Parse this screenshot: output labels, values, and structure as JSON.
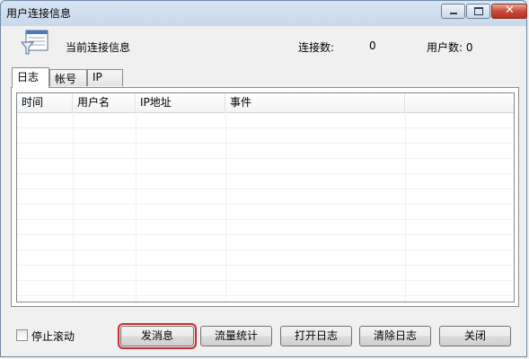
{
  "window": {
    "title": "用户连接信息"
  },
  "header": {
    "info_label": "当前连接信息",
    "conn_label": "连接数:",
    "conn_value": "0",
    "user_label": "用户数: 0"
  },
  "tabs": [
    "日志",
    "帐号",
    "IP"
  ],
  "log_table": {
    "columns": [
      "时间",
      "用户名",
      "IP地址",
      "事件"
    ],
    "rows": []
  },
  "footer": {
    "stop_scroll_label": "停止滚动",
    "stop_scroll_checked": false,
    "buttons": {
      "send_message": "发消息",
      "traffic_stats": "流量统计",
      "open_log": "打开日志",
      "clear_log": "清除日志",
      "close": "关闭"
    }
  }
}
